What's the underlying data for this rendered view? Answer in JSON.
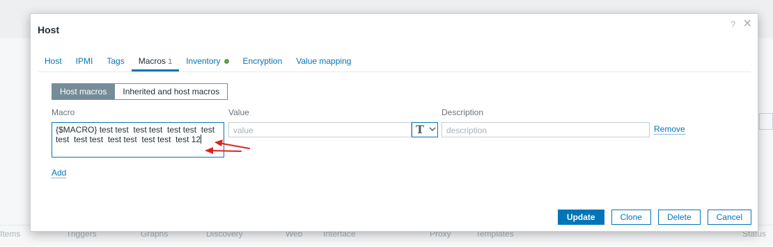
{
  "background": {
    "bottom_tabs": [
      "Items",
      "Triggers",
      "Graphs",
      "Discovery",
      "Web",
      "Interface",
      "Proxy",
      "Templates",
      "Status"
    ]
  },
  "dialog": {
    "title": "Host",
    "help_icon": "?",
    "close_icon": "✕"
  },
  "tabs": [
    {
      "label": "Host"
    },
    {
      "label": "IPMI"
    },
    {
      "label": "Tags"
    },
    {
      "label": "Macros",
      "count": "1",
      "active": true
    },
    {
      "label": "Inventory",
      "indicator": "green-dot"
    },
    {
      "label": "Encryption"
    },
    {
      "label": "Value mapping"
    }
  ],
  "macros": {
    "segments": {
      "host_macros": "Host macros",
      "inherited": "Inherited and host macros"
    },
    "columns": {
      "macro": "Macro",
      "value": "Value",
      "description": "Description"
    },
    "row": {
      "macro_value": "{$MACRO} test test  test test  test test  test\ntest  test test  test test  test test  test 12",
      "value_placeholder": "value",
      "type_icon": "T",
      "description_placeholder": "description",
      "remove_label": "Remove"
    },
    "add_label": "Add"
  },
  "footer": {
    "update": "Update",
    "clone": "Clone",
    "delete": "Delete",
    "cancel": "Cancel"
  },
  "colors": {
    "accent": "#0275b8",
    "annotation_arrow": "#e02020",
    "inventory_dot": "#59a247"
  }
}
